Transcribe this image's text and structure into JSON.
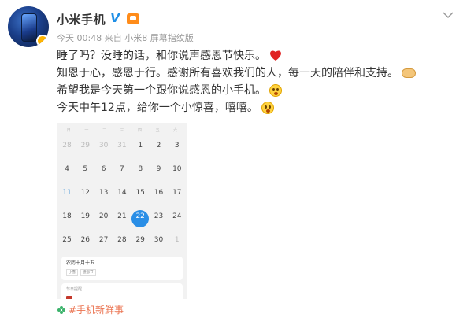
{
  "post": {
    "author": "小米手机",
    "time": "今天 00:48",
    "source_prefix": "来自",
    "source": "小米8 屏幕指纹版",
    "lines": [
      "睡了吗？没睡的话，和你说声感恩节快乐。",
      "知恩于心，感恩于行。感谢所有喜欢我们的人，每一天的陪伴和支持。",
      "希望我是今天第一个跟你说感恩的小手机。",
      "今天中午12点，给你一个小惊喜，嘻嘻。"
    ],
    "topic": "#手机新鲜事"
  },
  "icons": {
    "verified": "verified-v-icon",
    "level": "level-badge-icon",
    "dropdown": "chevron-down-icon",
    "heart": "red-heart-icon",
    "handshake": "handshake-icon",
    "scream_face": "scream-face-icon",
    "topic": "super-topic-icon"
  },
  "colors": {
    "topic": "#eb7350",
    "verified": "#1f8fe6",
    "today_highlight": "#2a8ee6"
  },
  "calendar": {
    "weekdays": [
      "日",
      "一",
      "二",
      "三",
      "四",
      "五",
      "六"
    ],
    "rows": [
      [
        {
          "d": "28",
          "s": "",
          "g": true
        },
        {
          "d": "29",
          "s": "",
          "g": true
        },
        {
          "d": "30",
          "s": "",
          "g": true
        },
        {
          "d": "31",
          "s": "",
          "g": true
        },
        {
          "d": "1",
          "s": "",
          "g": false
        },
        {
          "d": "2",
          "s": "",
          "g": false
        },
        {
          "d": "3",
          "s": "",
          "g": false
        }
      ],
      [
        {
          "d": "4",
          "s": "",
          "g": false
        },
        {
          "d": "5",
          "s": "",
          "g": false
        },
        {
          "d": "6",
          "s": "",
          "g": false
        },
        {
          "d": "7",
          "s": "",
          "g": false
        },
        {
          "d": "8",
          "s": "",
          "g": false
        },
        {
          "d": "9",
          "s": "",
          "g": false
        },
        {
          "d": "10",
          "s": "",
          "g": false
        }
      ],
      [
        {
          "d": "11",
          "s": "",
          "g": false,
          "b": true
        },
        {
          "d": "12",
          "s": "",
          "g": false
        },
        {
          "d": "13",
          "s": "",
          "g": false
        },
        {
          "d": "14",
          "s": "",
          "g": false
        },
        {
          "d": "15",
          "s": "",
          "g": false
        },
        {
          "d": "16",
          "s": "",
          "g": false
        },
        {
          "d": "17",
          "s": "",
          "g": false
        }
      ],
      [
        {
          "d": "18",
          "s": "",
          "g": false
        },
        {
          "d": "19",
          "s": "",
          "g": false
        },
        {
          "d": "20",
          "s": "",
          "g": false
        },
        {
          "d": "21",
          "s": "",
          "g": false
        },
        {
          "d": "22",
          "s": "",
          "g": false,
          "t": true
        },
        {
          "d": "23",
          "s": "",
          "g": false
        },
        {
          "d": "24",
          "s": "",
          "g": false
        }
      ],
      [
        {
          "d": "25",
          "s": "",
          "g": false
        },
        {
          "d": "26",
          "s": "",
          "g": false
        },
        {
          "d": "27",
          "s": "",
          "g": false
        },
        {
          "d": "28",
          "s": "",
          "g": false
        },
        {
          "d": "29",
          "s": "",
          "g": false
        },
        {
          "d": "30",
          "s": "",
          "g": false
        },
        {
          "d": "1",
          "s": "",
          "g": true
        }
      ]
    ],
    "card_title": "农历十月十五",
    "card_tags": [
      "小雪",
      "感恩节"
    ],
    "section_label": "节日提醒"
  }
}
